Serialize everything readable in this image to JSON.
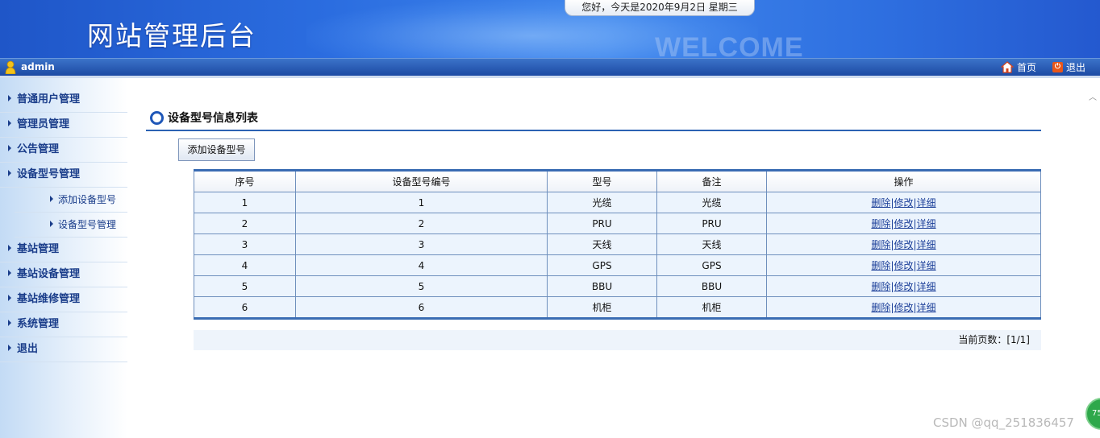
{
  "header": {
    "site_title": "网站管理后台",
    "greeting": "您好，今天是2020年9月2日 星期三",
    "welcome_mark": "WELCOME"
  },
  "userbar": {
    "username": "admin",
    "home_label": "首页",
    "logout_label": "退出"
  },
  "sidebar": {
    "items": [
      {
        "label": "普通用户管理",
        "level": 1
      },
      {
        "label": "管理员管理",
        "level": 1
      },
      {
        "label": "公告管理",
        "level": 1
      },
      {
        "label": "设备型号管理",
        "level": 1
      },
      {
        "label": "添加设备型号",
        "level": 2
      },
      {
        "label": "设备型号管理",
        "level": 2
      },
      {
        "label": "基站管理",
        "level": 1
      },
      {
        "label": "基站设备管理",
        "level": 1
      },
      {
        "label": "基站维修管理",
        "level": 1
      },
      {
        "label": "系统管理",
        "level": 1
      },
      {
        "label": "退出",
        "level": 1
      }
    ]
  },
  "main": {
    "title": "设备型号信息列表",
    "add_button": "添加设备型号",
    "table": {
      "columns": [
        "序号",
        "设备型号编号",
        "型号",
        "备注",
        "操作"
      ],
      "rows": [
        {
          "no": "1",
          "code": "1",
          "model": "光缆",
          "remark": "光缆"
        },
        {
          "no": "2",
          "code": "2",
          "model": "PRU",
          "remark": "PRU"
        },
        {
          "no": "3",
          "code": "3",
          "model": "天线",
          "remark": "天线"
        },
        {
          "no": "4",
          "code": "4",
          "model": "GPS",
          "remark": "GPS"
        },
        {
          "no": "5",
          "code": "5",
          "model": "BBU",
          "remark": "BBU"
        },
        {
          "no": "6",
          "code": "6",
          "model": "机柜",
          "remark": "机柜"
        }
      ],
      "actions": {
        "delete": "删除",
        "sep": "|",
        "edit": "修改",
        "detail": "详细"
      }
    },
    "pager": "当前页数：[1/1]"
  },
  "overlay": {
    "watermark": "CSDN @qq_251836457",
    "badge": "75"
  }
}
